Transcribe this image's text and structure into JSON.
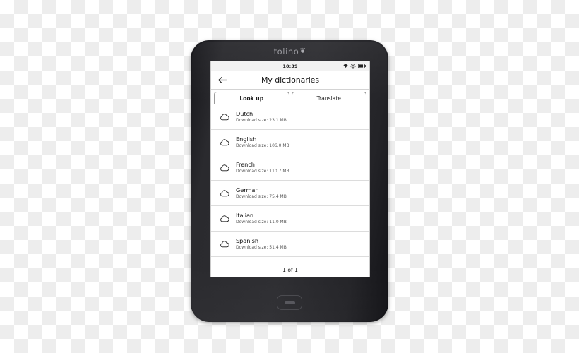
{
  "device": {
    "brand": "tolino",
    "brand_mark_glyph": "❦",
    "home_button_label": "home-button"
  },
  "statusbar": {
    "time": "10:39",
    "icons": [
      "wifi-icon",
      "brightness-icon",
      "battery-icon"
    ]
  },
  "header": {
    "back_icon": "back-arrow-icon",
    "title": "My dictionaries"
  },
  "tabs": [
    {
      "label": "Look up",
      "active": true
    },
    {
      "label": "Translate",
      "active": false
    }
  ],
  "dictionaries": [
    {
      "name": "Dutch",
      "size_label": "Download size:  23.1 MB",
      "icon": "cloud-download-icon"
    },
    {
      "name": "English",
      "size_label": "Download size:  106.0 MB",
      "icon": "cloud-download-icon"
    },
    {
      "name": "French",
      "size_label": "Download size:  110.7 MB",
      "icon": "cloud-download-icon"
    },
    {
      "name": "German",
      "size_label": "Download size:  75.4 MB",
      "icon": "cloud-download-icon"
    },
    {
      "name": "Italian",
      "size_label": "Download size:  11.0 MB",
      "icon": "cloud-download-icon"
    },
    {
      "name": "Spanish",
      "size_label": "Download size:  51.4 MB",
      "icon": "cloud-download-icon"
    }
  ],
  "pager": {
    "label": "1 of 1"
  },
  "colors": {
    "device_body": "#2b2b2f",
    "screen_bg": "#ffffff",
    "text_primary": "#111111",
    "text_secondary": "#585858",
    "separator": "#dcdcdc",
    "checker_light": "#ffffff",
    "checker_dark": "#ededed"
  }
}
